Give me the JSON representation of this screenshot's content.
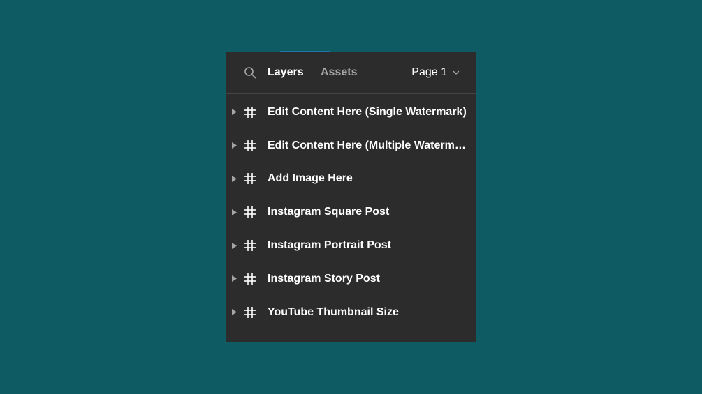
{
  "tabs": {
    "layers": "Layers",
    "assets": "Assets"
  },
  "page_select": {
    "label": "Page 1"
  },
  "layers": [
    {
      "label": "Edit Content Here (Single Watermark)"
    },
    {
      "label": "Edit Content Here (Multiple Watermarks)"
    },
    {
      "label": "Add Image Here"
    },
    {
      "label": "Instagram Square Post"
    },
    {
      "label": "Instagram Portrait Post"
    },
    {
      "label": "Instagram Story Post"
    },
    {
      "label": "YouTube Thumbnail Size"
    }
  ],
  "icons": {
    "search": "search-icon",
    "chevron": "chevron-down-icon",
    "caret": "caret-right-icon",
    "frame": "frame-hash-icon"
  },
  "colors": {
    "background": "#0e5b63",
    "panel": "#2c2c2c",
    "text_active": "#ffffff",
    "text_muted": "#a6a6a6"
  }
}
